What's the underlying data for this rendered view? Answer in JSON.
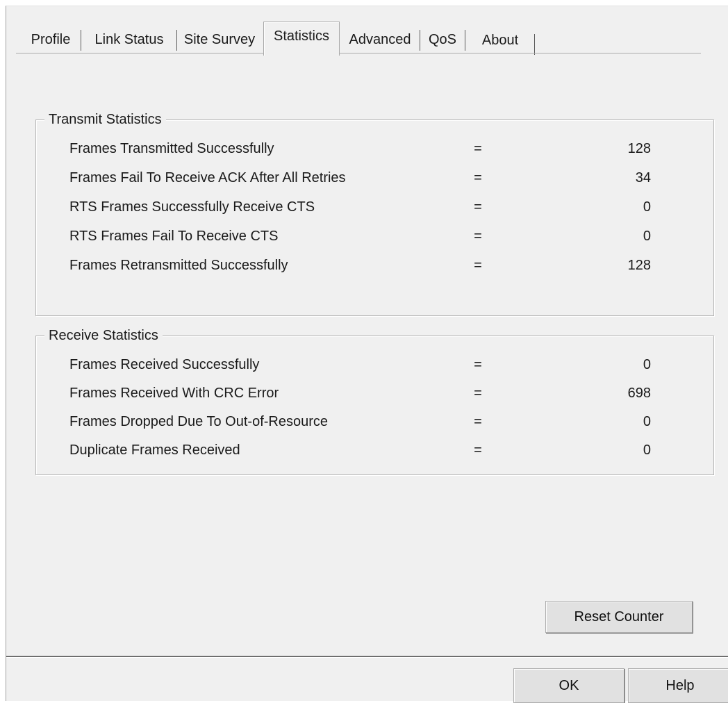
{
  "tabs": [
    {
      "label": "Profile"
    },
    {
      "label": "Link Status"
    },
    {
      "label": "Site Survey"
    },
    {
      "label": "Statistics"
    },
    {
      "label": "Advanced"
    },
    {
      "label": "QoS"
    },
    {
      "label": "About"
    }
  ],
  "active_tab": "Statistics",
  "transmit": {
    "title": "Transmit Statistics",
    "rows": [
      {
        "label": "Frames Transmitted Successfully",
        "eq": "=",
        "value": "128"
      },
      {
        "label": "Frames Fail To Receive ACK After All Retries",
        "eq": "=",
        "value": "34"
      },
      {
        "label": "RTS Frames Successfully Receive CTS",
        "eq": "=",
        "value": "0"
      },
      {
        "label": "RTS Frames Fail To Receive CTS",
        "eq": "=",
        "value": "0"
      },
      {
        "label": "Frames Retransmitted Successfully",
        "eq": "=",
        "value": "128"
      }
    ]
  },
  "receive": {
    "title": "Receive Statistics",
    "rows": [
      {
        "label": "Frames Received Successfully",
        "eq": "=",
        "value": "0"
      },
      {
        "label": "Frames Received With CRC Error",
        "eq": "=",
        "value": "698"
      },
      {
        "label": "Frames Dropped Due To Out-of-Resource",
        "eq": "=",
        "value": "0"
      },
      {
        "label": "Duplicate Frames Received",
        "eq": "=",
        "value": "0"
      }
    ]
  },
  "buttons": {
    "reset": "Reset Counter",
    "ok": "OK",
    "help": "Help"
  }
}
